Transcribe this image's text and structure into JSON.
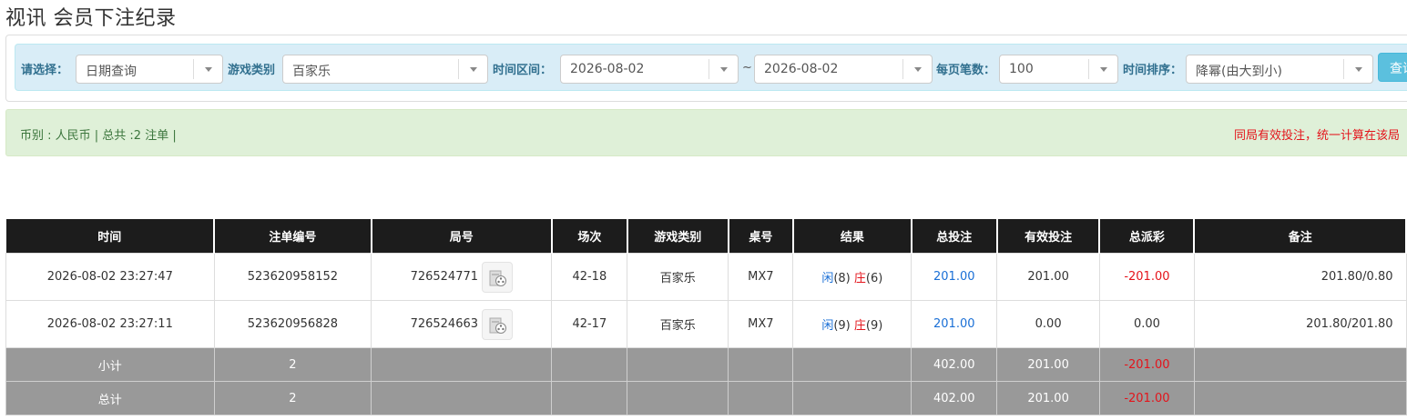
{
  "page": {
    "title": "视讯 会员下注纪录"
  },
  "filters": {
    "select_label": "请选择：",
    "select_value": "日期查询",
    "game_label": "游戏类别",
    "game_value": "百家乐",
    "range_label": "时间区间：",
    "start_date": "2026-08-02",
    "range_sep": "~",
    "end_date": "2026-08-02",
    "per_page_label": "每页笔数：",
    "per_page_value": "100",
    "sort_label": "时间排序：",
    "sort_value": "降幂(由大到小)",
    "query_label": "查询"
  },
  "info": {
    "summary": "币别 : 人民币 | 总共 :2 注单 |",
    "notice": "同局有效投注，统一计算在该局"
  },
  "table": {
    "headers": [
      "时间",
      "注单编号",
      "局号",
      "场次",
      "游戏类别",
      "桌号",
      "结果",
      "总投注",
      "有效投注",
      "总派彩",
      "备注"
    ],
    "rows": [
      {
        "time": "2026-08-02 23:27:47",
        "bet_id": "523620958152",
        "round": "726524771",
        "session": "42-18",
        "game": "百家乐",
        "table": "MX7",
        "result_player": "闲",
        "result_player_score": "(8)",
        "result_banker": "庄",
        "result_banker_score": "(6)",
        "total_bet": "201.00",
        "valid_bet": "201.00",
        "payout": "-201.00",
        "remark": "201.80/0.80"
      },
      {
        "time": "2026-08-02 23:27:11",
        "bet_id": "523620956828",
        "round": "726524663",
        "session": "42-17",
        "game": "百家乐",
        "table": "MX7",
        "result_player": "闲",
        "result_player_score": "(9)",
        "result_banker": "庄",
        "result_banker_score": "(9)",
        "total_bet": "201.00",
        "valid_bet": "0.00",
        "payout": "0.00",
        "remark": "201.80/201.80"
      }
    ],
    "subtotal": {
      "label": "小计",
      "count": "2",
      "total_bet": "402.00",
      "valid_bet": "201.00",
      "payout": "-201.00"
    },
    "grandtotal": {
      "label": "总计",
      "count": "2",
      "total_bet": "402.00",
      "valid_bet": "201.00",
      "payout": "-201.00"
    }
  },
  "colors": {
    "header_bg": "#1c1c1c",
    "filter_bg": "#d9edf7",
    "info_bg": "#dff0d8",
    "sum_row_bg": "#999999",
    "blue_amount": "#1a6fd6",
    "red_amount": "#e4141b",
    "query_button": "#5bc0de"
  },
  "icons": {
    "video_replay": "video-replay-icon",
    "dropdown": "chevron-down-icon"
  }
}
